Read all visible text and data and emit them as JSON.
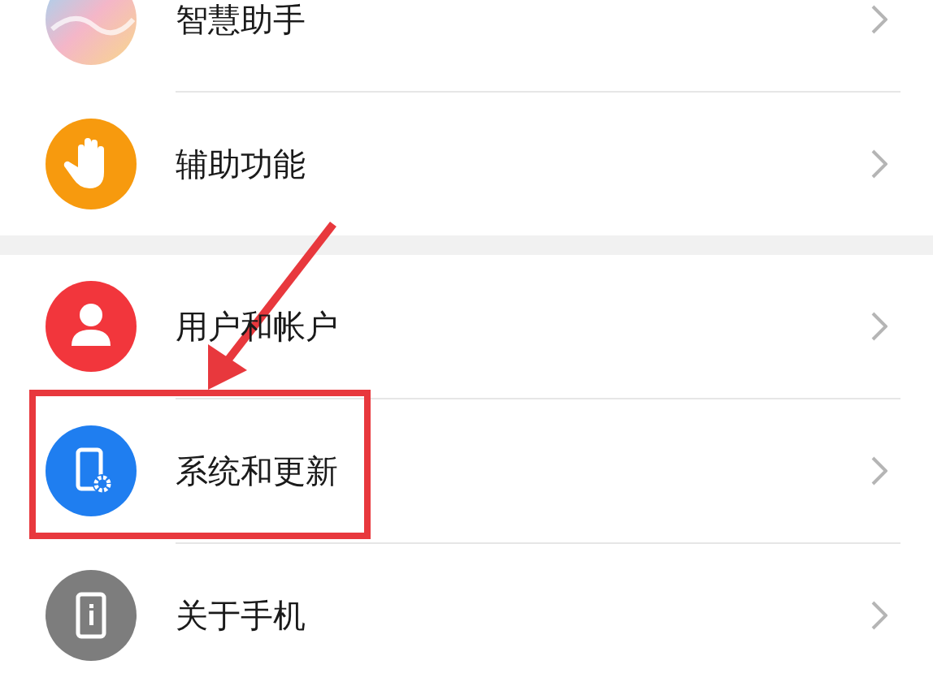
{
  "settings_list": [
    {
      "label": "智慧助手",
      "kind": "assistant",
      "color": "#f4b6c8",
      "highlighted": false
    },
    {
      "label": "辅助功能",
      "kind": "hand",
      "color": "#f79a0e",
      "highlighted": false
    },
    {
      "label": "用户和帐户",
      "kind": "person",
      "color": "#f2363c",
      "highlighted": false,
      "group_start": true
    },
    {
      "label": "系统和更新",
      "kind": "phone-gear",
      "color": "#1f7ef0",
      "highlighted": true
    },
    {
      "label": "关于手机",
      "kind": "phone-info",
      "color": "#7d7d7d",
      "highlighted": false
    }
  ]
}
